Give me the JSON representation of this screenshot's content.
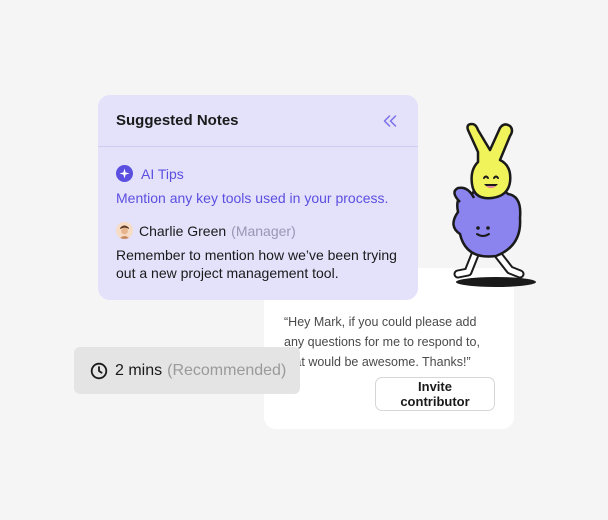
{
  "notes": {
    "title": "Suggested Notes",
    "ai_label": "AI Tips",
    "ai_tip": "Mention any key tools used in your process.",
    "person_name": "Charlie Green",
    "person_role": "(Manager)",
    "note_text": "Remember to mention how we’ve been trying out a new project management tool."
  },
  "invite": {
    "quote": "“Hey Mark, if you could please add any questions for me to respond to, that would be awesome. Thanks!”",
    "button_label": "Invite contributor"
  },
  "time": {
    "value": "2 mins",
    "recommendation": "(Recommended)"
  },
  "colors": {
    "accent": "#5b4fe0",
    "card_bg": "#e4e1fb",
    "mascot_yellow": "#f0f35a",
    "mascot_purple": "#8b84ee"
  },
  "icons": [
    "collapse-chevrons-icon",
    "sparkle-icon",
    "clock-icon"
  ]
}
